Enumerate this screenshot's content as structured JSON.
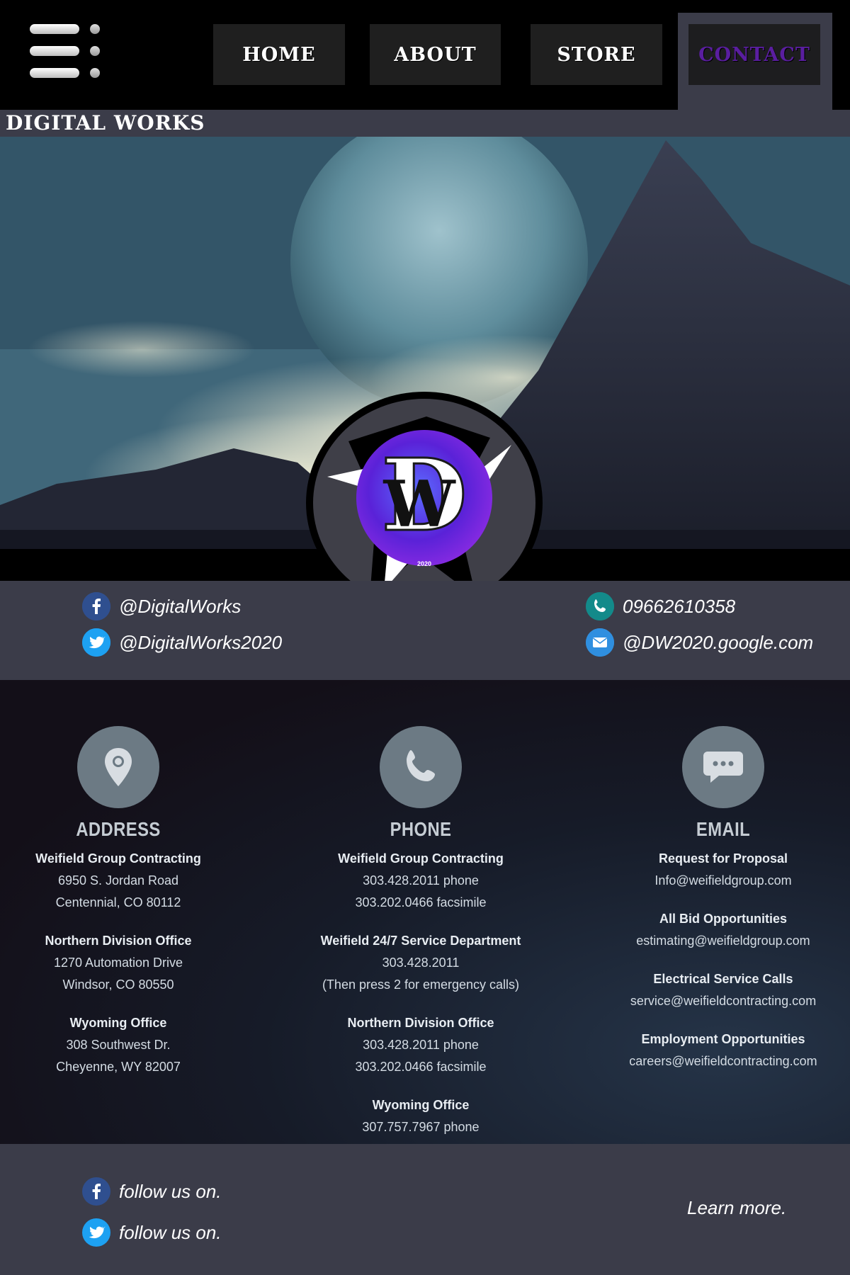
{
  "nav": {
    "home": "HOME",
    "about": "ABOUT",
    "store": "STORE",
    "contact": "CONTACT",
    "active_color": "#5a1ea0"
  },
  "site": {
    "title": "DIGITAL WORKS"
  },
  "logo": {
    "year": "2020"
  },
  "social": {
    "facebook": "@DigitalWorks",
    "twitter": "@DigitalWorks2020",
    "phone": "09662610358",
    "email": "@DW2020.google.com"
  },
  "contact": {
    "address": {
      "heading": "ADDRESS",
      "icon": "location-pin-icon",
      "entries": [
        {
          "title": "Weifield Group Contracting",
          "lines": [
            "6950 S. Jordan Road",
            "Centennial, CO 80112"
          ]
        },
        {
          "title": "Northern Division Office",
          "lines": [
            "1270 Automation Drive",
            "Windsor, CO 80550"
          ]
        },
        {
          "title": "Wyoming Office",
          "lines": [
            "308 Southwest Dr.",
            "Cheyenne, WY 82007"
          ]
        }
      ]
    },
    "phone": {
      "heading": "PHONE",
      "icon": "phone-icon",
      "entries": [
        {
          "title": "Weifield Group Contracting",
          "lines": [
            "303.428.2011 phone",
            "303.202.0466 facsimile"
          ]
        },
        {
          "title": "Weifield 24/7 Service Department",
          "lines": [
            "303.428.2011",
            "(Then press 2 for emergency calls)"
          ]
        },
        {
          "title": "Northern Division Office",
          "lines": [
            "303.428.2011 phone",
            "303.202.0466 facsimile"
          ]
        },
        {
          "title": "Wyoming Office",
          "lines": [
            "307.757.7967 phone"
          ]
        }
      ]
    },
    "email": {
      "heading": "EMAIL",
      "icon": "chat-bubble-icon",
      "entries": [
        {
          "title": "Request for Proposal",
          "lines": [
            "Info@weifieldgroup.com"
          ]
        },
        {
          "title": "All Bid Opportunities",
          "lines": [
            "estimating@weifieldgroup.com"
          ]
        },
        {
          "title": "Electrical Service Calls",
          "lines": [
            "service@weifieldcontracting.com"
          ]
        },
        {
          "title": "Employment Opportunities",
          "lines": [
            "careers@weifieldcontracting.com"
          ]
        }
      ]
    }
  },
  "footer": {
    "facebook_follow": "follow us on.",
    "twitter_follow": "follow us on.",
    "learn_more": "Learn more."
  },
  "colors": {
    "panel": "#3b3c49",
    "facebook": "#3b5998",
    "twitter": "#1da1f2",
    "phone_badge": "#1a8a8a",
    "mail_badge": "#4aa3e8"
  }
}
